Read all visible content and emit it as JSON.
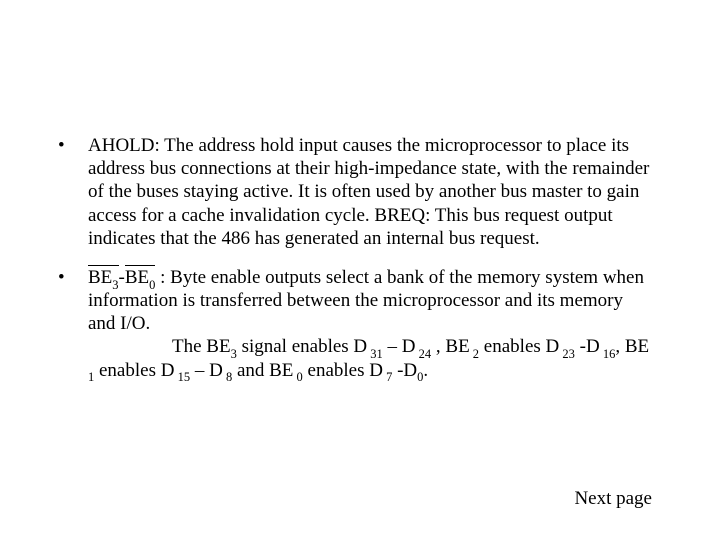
{
  "bullets": {
    "ahold": {
      "text": "AHOLD: The address hold input causes the microprocessor to place its address bus connections at their high-impedance state, with the remainder of the buses staying active. It is often used by another bus master to gain access for a cache invalidation cycle. BREQ: This bus request output indicates that the 486 has generated an internal bus request."
    },
    "be": {
      "lead": " ",
      "sig1a": "BE",
      "sub1a": "3",
      "dash": "-",
      "sig1b": "BE",
      "sub1b": "0",
      "rest1": " : Byte enable outputs select a bank of the memory system when information is transferred between the microprocessor and its memory  and I/O.",
      "line2_pre": "The BE",
      "line2_sub1": "3",
      "line2_a": " signal enables D",
      "line2_sub2": " 31",
      "line2_b": " – D",
      "line2_sub3": " 24",
      "line2_c": " , BE",
      "line2_sub4": " 2",
      "line2_d": " enables D",
      "line2_sub5": " 23",
      "line3_a": " -D",
      "line3_sub1": " 16",
      "line3_b": ", BE",
      "line3_sub2": " 1",
      "line3_c": "  enables D",
      "line3_sub3": " 15",
      "line3_d": " – D",
      "line3_sub4": " 8",
      "line3_e": " and BE",
      "line3_sub5": " 0",
      "line3_f": " enables D",
      "line3_sub6": " 7",
      "line3_g": " -D",
      "line3_sub7": "0",
      "line3_h": "."
    }
  },
  "footer": {
    "next": "Next page"
  }
}
